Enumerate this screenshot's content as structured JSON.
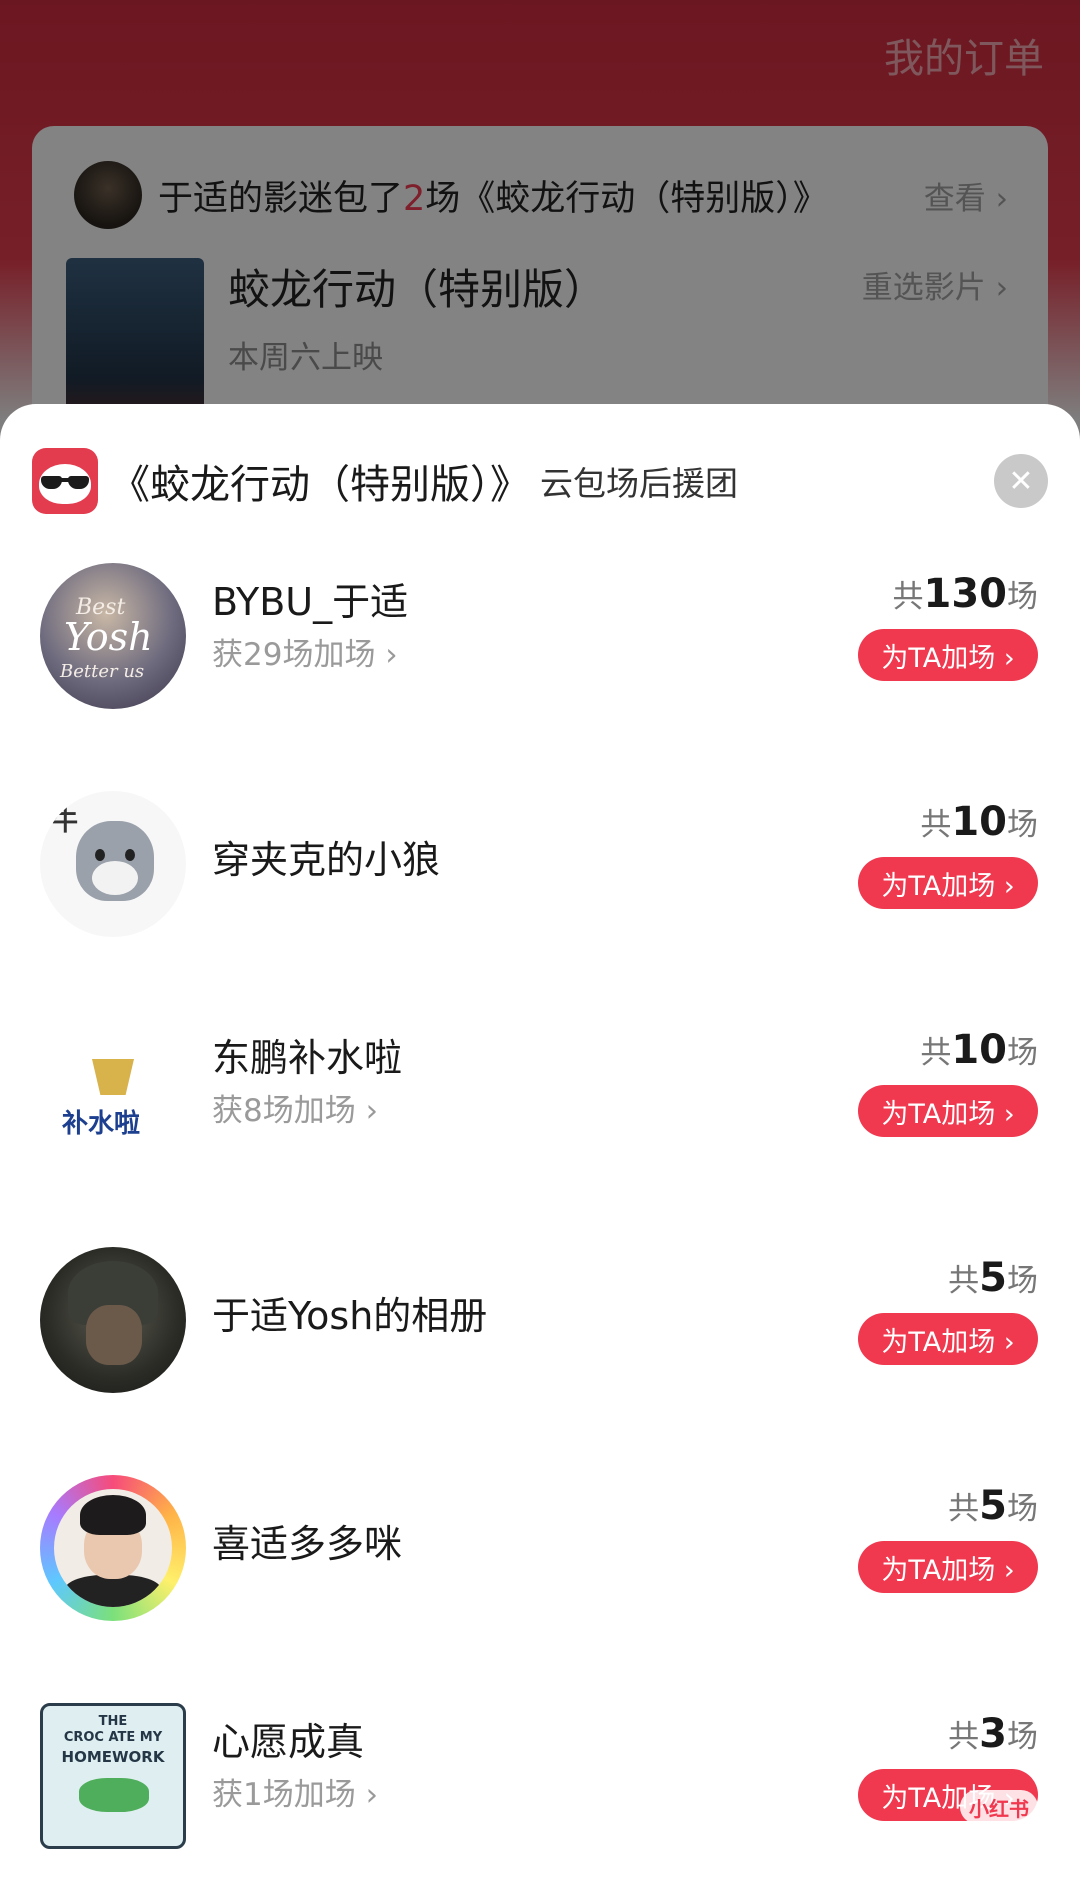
{
  "background": {
    "my_orders": "我的订单",
    "fan_banner": {
      "prefix": "于适的影迷包了",
      "count": "2",
      "suffix": "场《蛟龙行动（特别版）》",
      "view_label": "查看 ›"
    },
    "movie": {
      "title": "蛟龙行动（特别版）",
      "reselect_label": "重选影片 ›",
      "release": "本周六上映"
    }
  },
  "sheet": {
    "title": "《蛟龙行动（特别版）》",
    "subtitle": "云包场后援团",
    "close_icon": "✕"
  },
  "list": [
    {
      "name": "BYBU_于适",
      "sub": "获29场加场 ›",
      "total_prefix": "共",
      "total": "130",
      "total_suffix": "场",
      "button": "为TA加场 ›"
    },
    {
      "name": "穿夹克的小狼",
      "total_prefix": "共",
      "total": "10",
      "total_suffix": "场",
      "button": "为TA加场 ›"
    },
    {
      "name": "东鹏补水啦",
      "sub": "获8场加场 ›",
      "total_prefix": "共",
      "total": "10",
      "total_suffix": "场",
      "button": "为TA加场 ›"
    },
    {
      "name": "于适Yosh的相册",
      "total_prefix": "共",
      "total": "5",
      "total_suffix": "场",
      "button": "为TA加场 ›"
    },
    {
      "name": "喜适多多咪",
      "total_prefix": "共",
      "total": "5",
      "total_suffix": "场",
      "button": "为TA加场 ›"
    },
    {
      "name": "心愿成真",
      "sub": "获1场加场 ›",
      "total_prefix": "共",
      "total": "3",
      "total_suffix": "场",
      "button": "为TA加场 ›"
    }
  ],
  "avatar_text": {
    "a1": [
      "Best",
      "Yosh",
      "Better us"
    ],
    "a2": "牛",
    "a3": "补水啦",
    "a6": [
      "THE",
      "CROC ATE MY",
      "HOMEWORK"
    ]
  },
  "watermark": "小红书",
  "colors": {
    "accent": "#f0384f",
    "brand_red": "#e33c4e"
  }
}
